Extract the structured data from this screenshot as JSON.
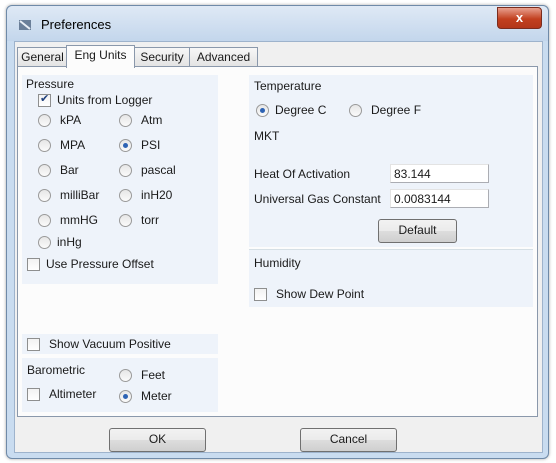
{
  "window": {
    "title": "Preferences",
    "close_glyph": "x"
  },
  "tabs": [
    {
      "label": "General"
    },
    {
      "label": "Eng Units",
      "active": true
    },
    {
      "label": "Security"
    },
    {
      "label": "Advanced"
    }
  ],
  "pressure": {
    "heading": "Pressure",
    "units_from_logger": {
      "label": "Units from Logger",
      "checked": true
    },
    "units": [
      {
        "label": "kPA",
        "selected": false
      },
      {
        "label": "Atm",
        "selected": false
      },
      {
        "label": "MPA",
        "selected": false
      },
      {
        "label": "PSI",
        "selected": true
      },
      {
        "label": "Bar",
        "selected": false
      },
      {
        "label": "pascal",
        "selected": false
      },
      {
        "label": "milliBar",
        "selected": false
      },
      {
        "label": "inH20",
        "selected": false
      },
      {
        "label": "mmHG",
        "selected": false
      },
      {
        "label": "torr",
        "selected": false
      },
      {
        "label": "inHg",
        "selected": false
      }
    ],
    "use_offset": {
      "label": "Use Pressure Offset",
      "checked": false
    }
  },
  "vacuum": {
    "label": "Show Vacuum Positive",
    "checked": false
  },
  "barometric": {
    "heading": "Barometric",
    "altimeter": {
      "label": "Altimeter",
      "checked": false
    },
    "feet": {
      "label": "Feet",
      "selected": false
    },
    "meter": {
      "label": "Meter",
      "selected": true
    }
  },
  "temperature": {
    "heading": "Temperature",
    "degree_c": {
      "label": "Degree C",
      "selected": true
    },
    "degree_f": {
      "label": "Degree F",
      "selected": false
    }
  },
  "mkt": {
    "heading": "MKT",
    "heat_label": "Heat Of Activation",
    "heat_value": "83.144",
    "gas_label": "Universal Gas Constant",
    "gas_value": "0.0083144",
    "default_button": "Default"
  },
  "humidity": {
    "heading": "Humidity",
    "show_dew_point": {
      "label": "Show Dew Point",
      "checked": false
    }
  },
  "footer": {
    "ok_button": "OK",
    "cancel_button": "Cancel"
  },
  "colors": {
    "accent": "#2d63b4",
    "close": "#c2401f",
    "group_bg": "#eef3fa",
    "frame": "#c9dcf0"
  }
}
